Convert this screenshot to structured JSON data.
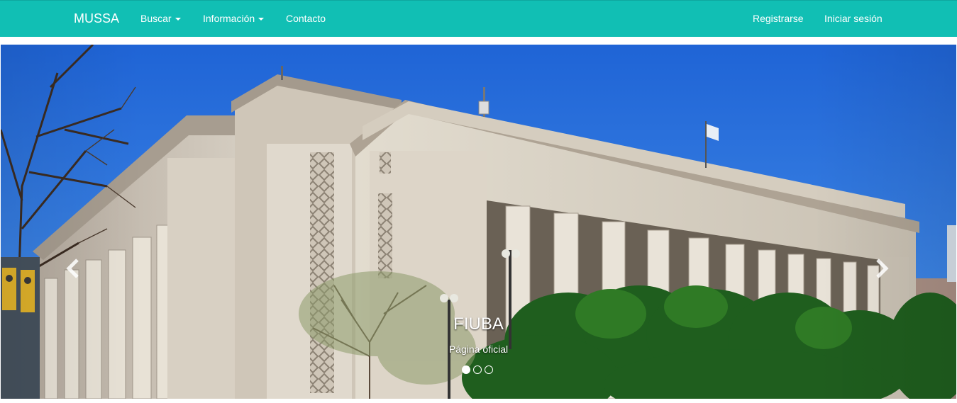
{
  "navbar": {
    "brand": "MUSSA",
    "left_items": [
      {
        "label": "Buscar",
        "dropdown": true
      },
      {
        "label": "Información",
        "dropdown": true
      },
      {
        "label": "Contacto",
        "dropdown": false
      }
    ],
    "right_items": [
      {
        "label": "Registrarse"
      },
      {
        "label": "Iniciar sesión"
      }
    ],
    "color": "#11bfb4"
  },
  "carousel": {
    "slides": [
      {
        "title": "FIUBA",
        "subtitle": "Página oficial",
        "active": true
      },
      {
        "active": false
      },
      {
        "active": false
      }
    ],
    "prev_icon": "chevron-left-icon",
    "next_icon": "chevron-right-icon"
  }
}
